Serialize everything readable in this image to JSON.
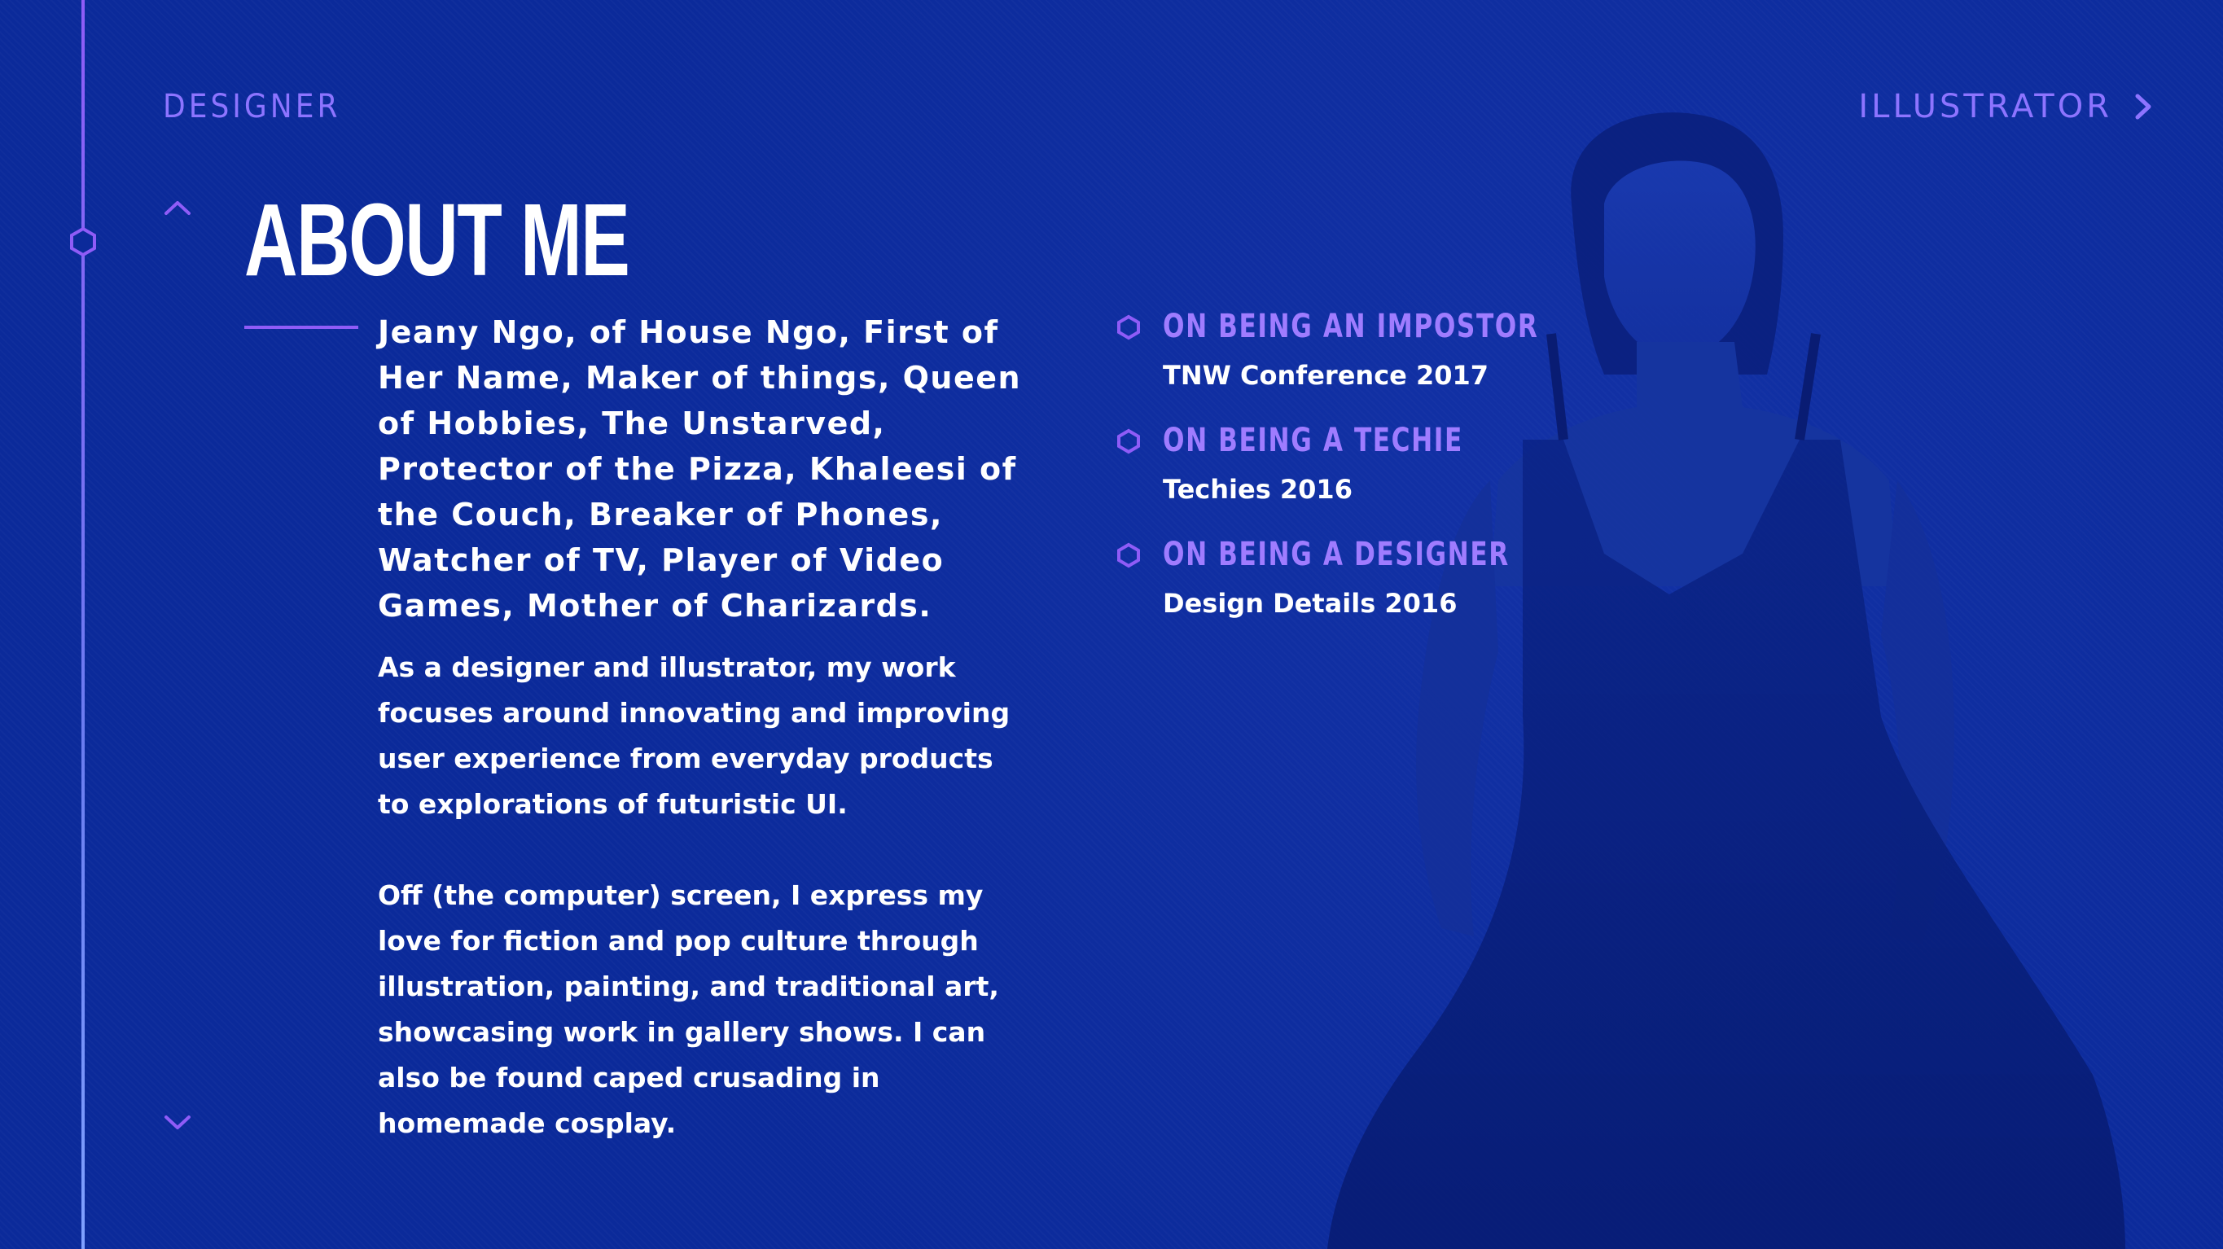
{
  "nav": {
    "left_label": "DESIGNER",
    "right_label": "ILLUSTRATOR"
  },
  "header": {
    "title": "ABOUT ME"
  },
  "about": {
    "lead": "Jeany Ngo, of House Ngo, First of Her Name, Maker of things, Queen of Hobbies, The Unstarved, Protector of the Pizza, Khaleesi of the Couch, Breaker of Phones, Watcher of TV, Player of Video Games, Mother of Charizards.",
    "paragraph_1": "As a designer and illustrator, my work focuses around innovating and improving user experience from everyday products to explorations of futuristic UI.",
    "paragraph_2": "Off (the computer) screen, I express my love for fiction and pop culture through illustration, painting, and traditional art, showcasing work in gallery shows. I can also be found caped crusading in homemade cosplay."
  },
  "talks": [
    {
      "title": "ON BEING AN IMPOSTOR",
      "event": "TNW Conference 2017"
    },
    {
      "title": "ON BEING A TECHIE",
      "event": "Techies 2016"
    },
    {
      "title": "ON BEING A DESIGNER",
      "event": "Design Details 2016"
    }
  ],
  "icons": {
    "timeline_marker": "hexagon-icon",
    "talk_marker": "hexagon-icon",
    "next": "chevron-right-icon",
    "prev_section": "chevron-up-icon",
    "next_section": "chevron-down-icon"
  },
  "colors": {
    "background": "#0b2a9a",
    "accent": "#8f5cf7",
    "nav_text": "#8d74ff",
    "talk_title": "#9f7cff",
    "text": "#ffffff"
  }
}
